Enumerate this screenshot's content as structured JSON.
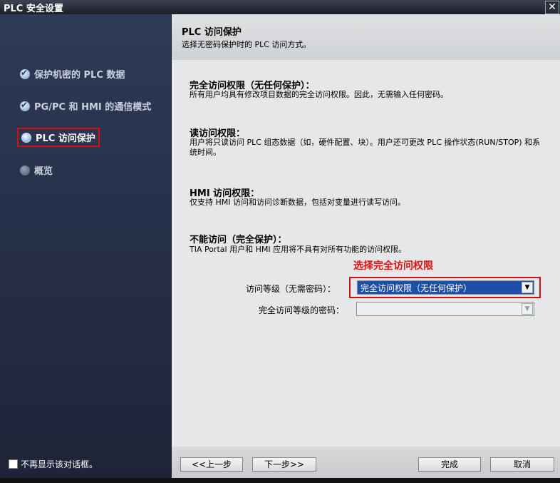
{
  "window": {
    "title": "PLC 安全设置",
    "close_label": "✕"
  },
  "sidebar": {
    "items": [
      {
        "label": "保护机密的 PLC 数据",
        "state": "done"
      },
      {
        "label": "PG/PC 和 HMI 的通信模式",
        "state": "done"
      },
      {
        "label": "PLC 访问保护",
        "state": "current"
      },
      {
        "label": "概览",
        "state": "pending"
      }
    ],
    "dont_show_label": "不再显示该对话框。"
  },
  "header": {
    "title": "PLC 访问保护",
    "subtitle": "选择无密码保护时的 PLC 访问方式。"
  },
  "sections": [
    {
      "title": "完全访问权限（无任何保护）：",
      "desc": "所有用户均具有修改项目数据的完全访问权限。因此，无需输入任何密码。"
    },
    {
      "title": "读访问权限：",
      "desc": "用户将只读访问 PLC 组态数据（如，硬件配置、块）。用户还可更改 PLC 操作状态(RUN/STOP) 和系统时间。"
    },
    {
      "title": "HMI 访问权限：",
      "desc": "仅支持 HMI 访问和访问诊断数据，包括对变量进行读写访问。"
    },
    {
      "title": "不能访问（完全保护）：",
      "desc": "TIA Portal 用户和 HMI 应用将不具有对所有功能的访问权限。"
    }
  ],
  "annotation": "选择完全访问权限",
  "form": {
    "access_level_label": "访问等级（无需密码）：",
    "access_level_value": "完全访问权限（无任何保护）",
    "password_label": "完全访问等级的密码：",
    "password_value": ""
  },
  "footer": {
    "prev": "<<上一步",
    "next": "下一步>>",
    "finish": "完成",
    "cancel": "取消"
  },
  "colors": {
    "highlight": "#d01010",
    "selected": "#1d4fa8"
  }
}
